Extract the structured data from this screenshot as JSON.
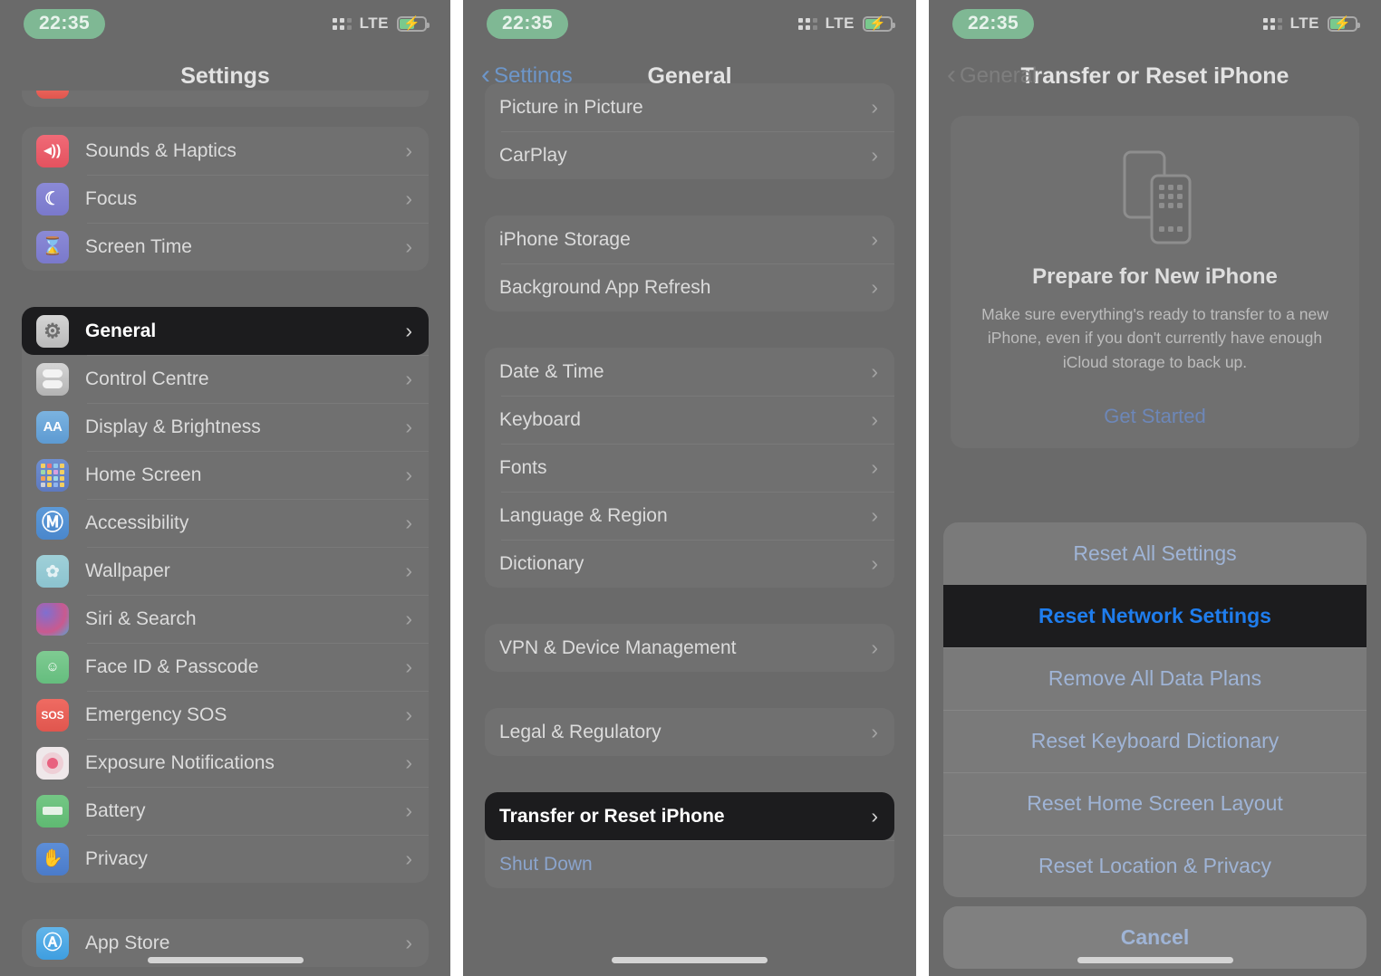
{
  "statusbar": {
    "time": "22:35",
    "carrier": "LTE",
    "signal_icon": "signal-dots-icon",
    "battery_icon": "battery-charging-icon",
    "time_pill_color": "#7fb894"
  },
  "colors": {
    "panel_background": "#6a6a6a",
    "group_background": "#707070",
    "spotlight_background": "#1c1c1e",
    "accent_blue": "#1f7ded",
    "muted_blue": "#9fb4d6"
  },
  "panel1": {
    "nav": {
      "title": "Settings"
    },
    "partial_top_row": {
      "icon": "notifications-icon"
    },
    "groups": [
      {
        "rows": [
          {
            "label": "Sounds & Haptics",
            "icon": "speaker-icon",
            "icon_class": "ic-sound",
            "glyph": "◂))",
            "chevron": "›"
          },
          {
            "label": "Focus",
            "icon": "moon-icon",
            "icon_class": "ic-focus",
            "glyph": "☾",
            "chevron": "›"
          },
          {
            "label": "Screen Time",
            "icon": "hourglass-icon",
            "icon_class": "ic-screen",
            "glyph": "⧗",
            "chevron": "›"
          }
        ]
      },
      {
        "rows": [
          {
            "label": "General",
            "icon": "gear-icon",
            "icon_class": "ic-general",
            "glyph": "⚙",
            "chevron": "›",
            "spotlight": true
          },
          {
            "label": "Control Centre",
            "icon": "control-centre-icon",
            "icon_class": "ic-control",
            "glyph": "",
            "chevron": "›"
          },
          {
            "label": "Display & Brightness",
            "icon": "text-size-icon",
            "icon_class": "ic-display",
            "glyph": "AA",
            "chevron": "›"
          },
          {
            "label": "Home Screen",
            "icon": "app-grid-icon",
            "icon_class": "ic-home",
            "glyph": "",
            "chevron": "›"
          },
          {
            "label": "Accessibility",
            "icon": "accessibility-icon",
            "icon_class": "ic-access",
            "glyph": "Ⓙ",
            "chevron": "›"
          },
          {
            "label": "Wallpaper",
            "icon": "wallpaper-icon",
            "icon_class": "ic-wall",
            "glyph": "✿",
            "chevron": "›"
          },
          {
            "label": "Siri & Search",
            "icon": "siri-icon",
            "icon_class": "ic-siri",
            "glyph": "",
            "chevron": "›"
          },
          {
            "label": "Face ID & Passcode",
            "icon": "face-id-icon",
            "icon_class": "ic-faceid",
            "glyph": "☰",
            "chevron": "›"
          },
          {
            "label": "Emergency SOS",
            "icon": "sos-icon",
            "icon_class": "ic-sos",
            "glyph": "SOS",
            "chevron": "›"
          },
          {
            "label": "Exposure Notifications",
            "icon": "exposure-notifications-icon",
            "icon_class": "ic-expo",
            "glyph": "",
            "chevron": "›"
          },
          {
            "label": "Battery",
            "icon": "battery-icon",
            "icon_class": "ic-batt",
            "glyph": "",
            "chevron": "›"
          },
          {
            "label": "Privacy",
            "icon": "hand-icon",
            "icon_class": "ic-priv",
            "glyph": "✋",
            "chevron": "›"
          }
        ]
      },
      {
        "rows": [
          {
            "label": "App Store",
            "icon": "app-store-icon",
            "icon_class": "ic-appstore",
            "glyph": "Ⓐ",
            "chevron": "›"
          }
        ]
      }
    ]
  },
  "panel2": {
    "nav": {
      "back_label": "Settings",
      "back_chevron": "‹",
      "title": "General"
    },
    "groups": [
      {
        "rows": [
          {
            "label": "Picture in Picture",
            "chevron": "›"
          },
          {
            "label": "CarPlay",
            "chevron": "›"
          }
        ]
      },
      {
        "rows": [
          {
            "label": "iPhone Storage",
            "chevron": "›"
          },
          {
            "label": "Background App Refresh",
            "chevron": "›"
          }
        ]
      },
      {
        "rows": [
          {
            "label": "Date & Time",
            "chevron": "›"
          },
          {
            "label": "Keyboard",
            "chevron": "›"
          },
          {
            "label": "Fonts",
            "chevron": "›"
          },
          {
            "label": "Language & Region",
            "chevron": "›"
          },
          {
            "label": "Dictionary",
            "chevron": "›"
          }
        ]
      },
      {
        "rows": [
          {
            "label": "VPN & Device Management",
            "chevron": "›"
          }
        ]
      },
      {
        "rows": [
          {
            "label": "Legal & Regulatory",
            "chevron": "›"
          }
        ]
      },
      {
        "rows": [
          {
            "label": "Transfer or Reset iPhone",
            "chevron": "›",
            "spotlight": true
          },
          {
            "label": "Shut Down",
            "chevron": "",
            "link": true
          }
        ]
      }
    ]
  },
  "panel3": {
    "nav": {
      "back_label": "General",
      "back_chevron": "‹",
      "title": "Transfer or Reset iPhone"
    },
    "card": {
      "illustration": "two-iphones-icon",
      "title": "Prepare for New iPhone",
      "description": "Make sure everything's ready to transfer to a new iPhone, even if you don't currently have enough iCloud storage to back up.",
      "cta_label": "Get Started"
    },
    "action_sheet": {
      "options": [
        {
          "label": "Reset All Settings",
          "spotlight": false
        },
        {
          "label": "Reset Network Settings",
          "spotlight": true
        },
        {
          "label": "Remove All Data Plans",
          "spotlight": false
        },
        {
          "label": "Reset Keyboard Dictionary",
          "spotlight": false
        },
        {
          "label": "Reset Home Screen Layout",
          "spotlight": false
        },
        {
          "label": "Reset Location & Privacy",
          "spotlight": false
        }
      ],
      "cancel_label": "Cancel"
    }
  }
}
